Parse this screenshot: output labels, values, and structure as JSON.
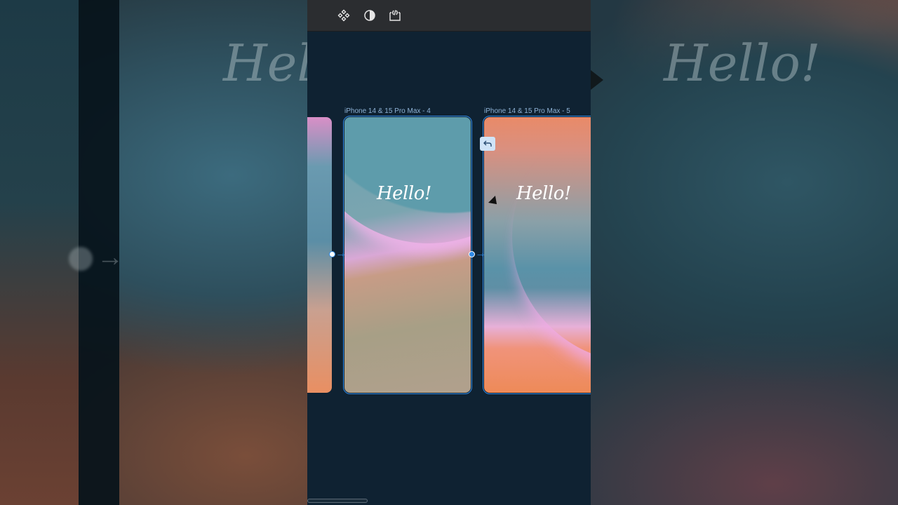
{
  "toolbar": {
    "tools": [
      {
        "name": "component-icon"
      },
      {
        "name": "contrast-icon"
      },
      {
        "name": "frame-code-icon"
      }
    ]
  },
  "background": {
    "left_text": "Hello!",
    "right_text": "Hello!"
  },
  "frames": [
    {
      "label": "iPhone 14 & 15 Pro Max - 4",
      "text": "Hello!",
      "selected": true
    },
    {
      "label": "iPhone 14 & 15 Pro Max - 5",
      "text": "Hello!",
      "selected": true
    }
  ],
  "icons": {
    "back_badge": "return-arrow-icon",
    "connector_arrow": "→"
  },
  "colors": {
    "selection": "#2f8ae6",
    "canvas": "#0f2232",
    "toolbar": "#2b2d30"
  }
}
